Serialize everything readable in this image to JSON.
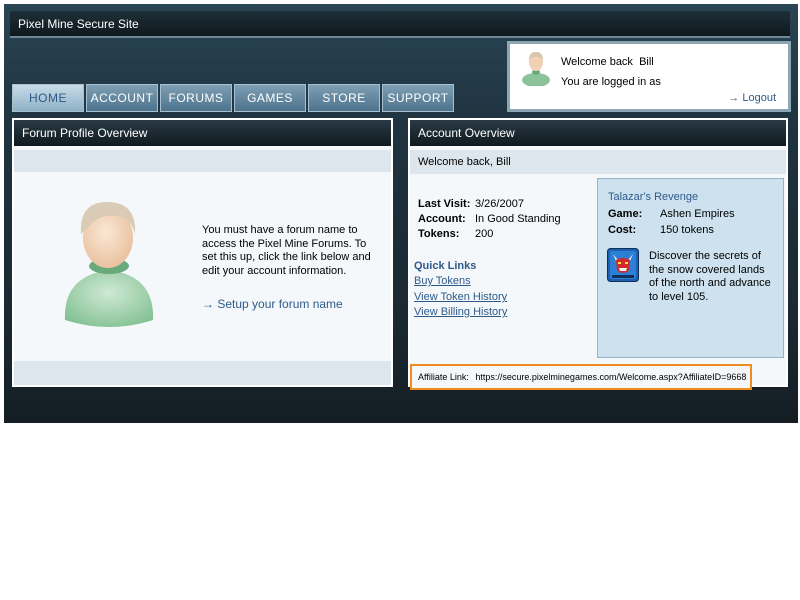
{
  "site": {
    "title": "Pixel Mine Secure Site"
  },
  "login": {
    "welcome_prefix": "Welcome back",
    "user_name": "Bill",
    "logged_in_text": "You are logged in as",
    "logout_label": "→ Logout"
  },
  "nav": {
    "items": [
      {
        "label": "HOME",
        "active": true
      },
      {
        "label": "ACCOUNT"
      },
      {
        "label": "FORUMS"
      },
      {
        "label": "GAMES"
      },
      {
        "label": "STORE"
      },
      {
        "label": "SUPPORT"
      }
    ]
  },
  "forum_panel": {
    "title": "Forum Profile Overview",
    "message": "You must have a forum name to access the Pixel Mine Forums. To set this up, click the link below and edit your account information.",
    "setup_link": "→ Setup your forum name"
  },
  "account_panel": {
    "title": "Account Overview",
    "welcome": "Welcome back, Bill",
    "last_visit_label": "Last Visit:",
    "last_visit_value": "3/26/2007",
    "account_label": "Account:",
    "account_value": "In Good Standing",
    "tokens_label": "Tokens:",
    "tokens_value": "200",
    "quick_links_heading": "Quick Links",
    "quick_links": [
      "Buy Tokens",
      "View Token History",
      "View Billing History"
    ]
  },
  "featured_game": {
    "title": "Talazar's Revenge",
    "game_label": "Game:",
    "game_value": "Ashen Empires",
    "cost_label": "Cost:",
    "cost_value": "150 tokens",
    "description": "Discover the secrets of the snow covered lands of the north and advance to level 105."
  },
  "affiliate": {
    "label": "Affiliate Link:",
    "url": "https://secure.pixelminegames.com/Welcome.aspx?AffiliateID=9668"
  },
  "colors": {
    "accent": "#2e5a8a",
    "affiliate_border": "#f08c1e",
    "header_dark": "#1f3340"
  }
}
